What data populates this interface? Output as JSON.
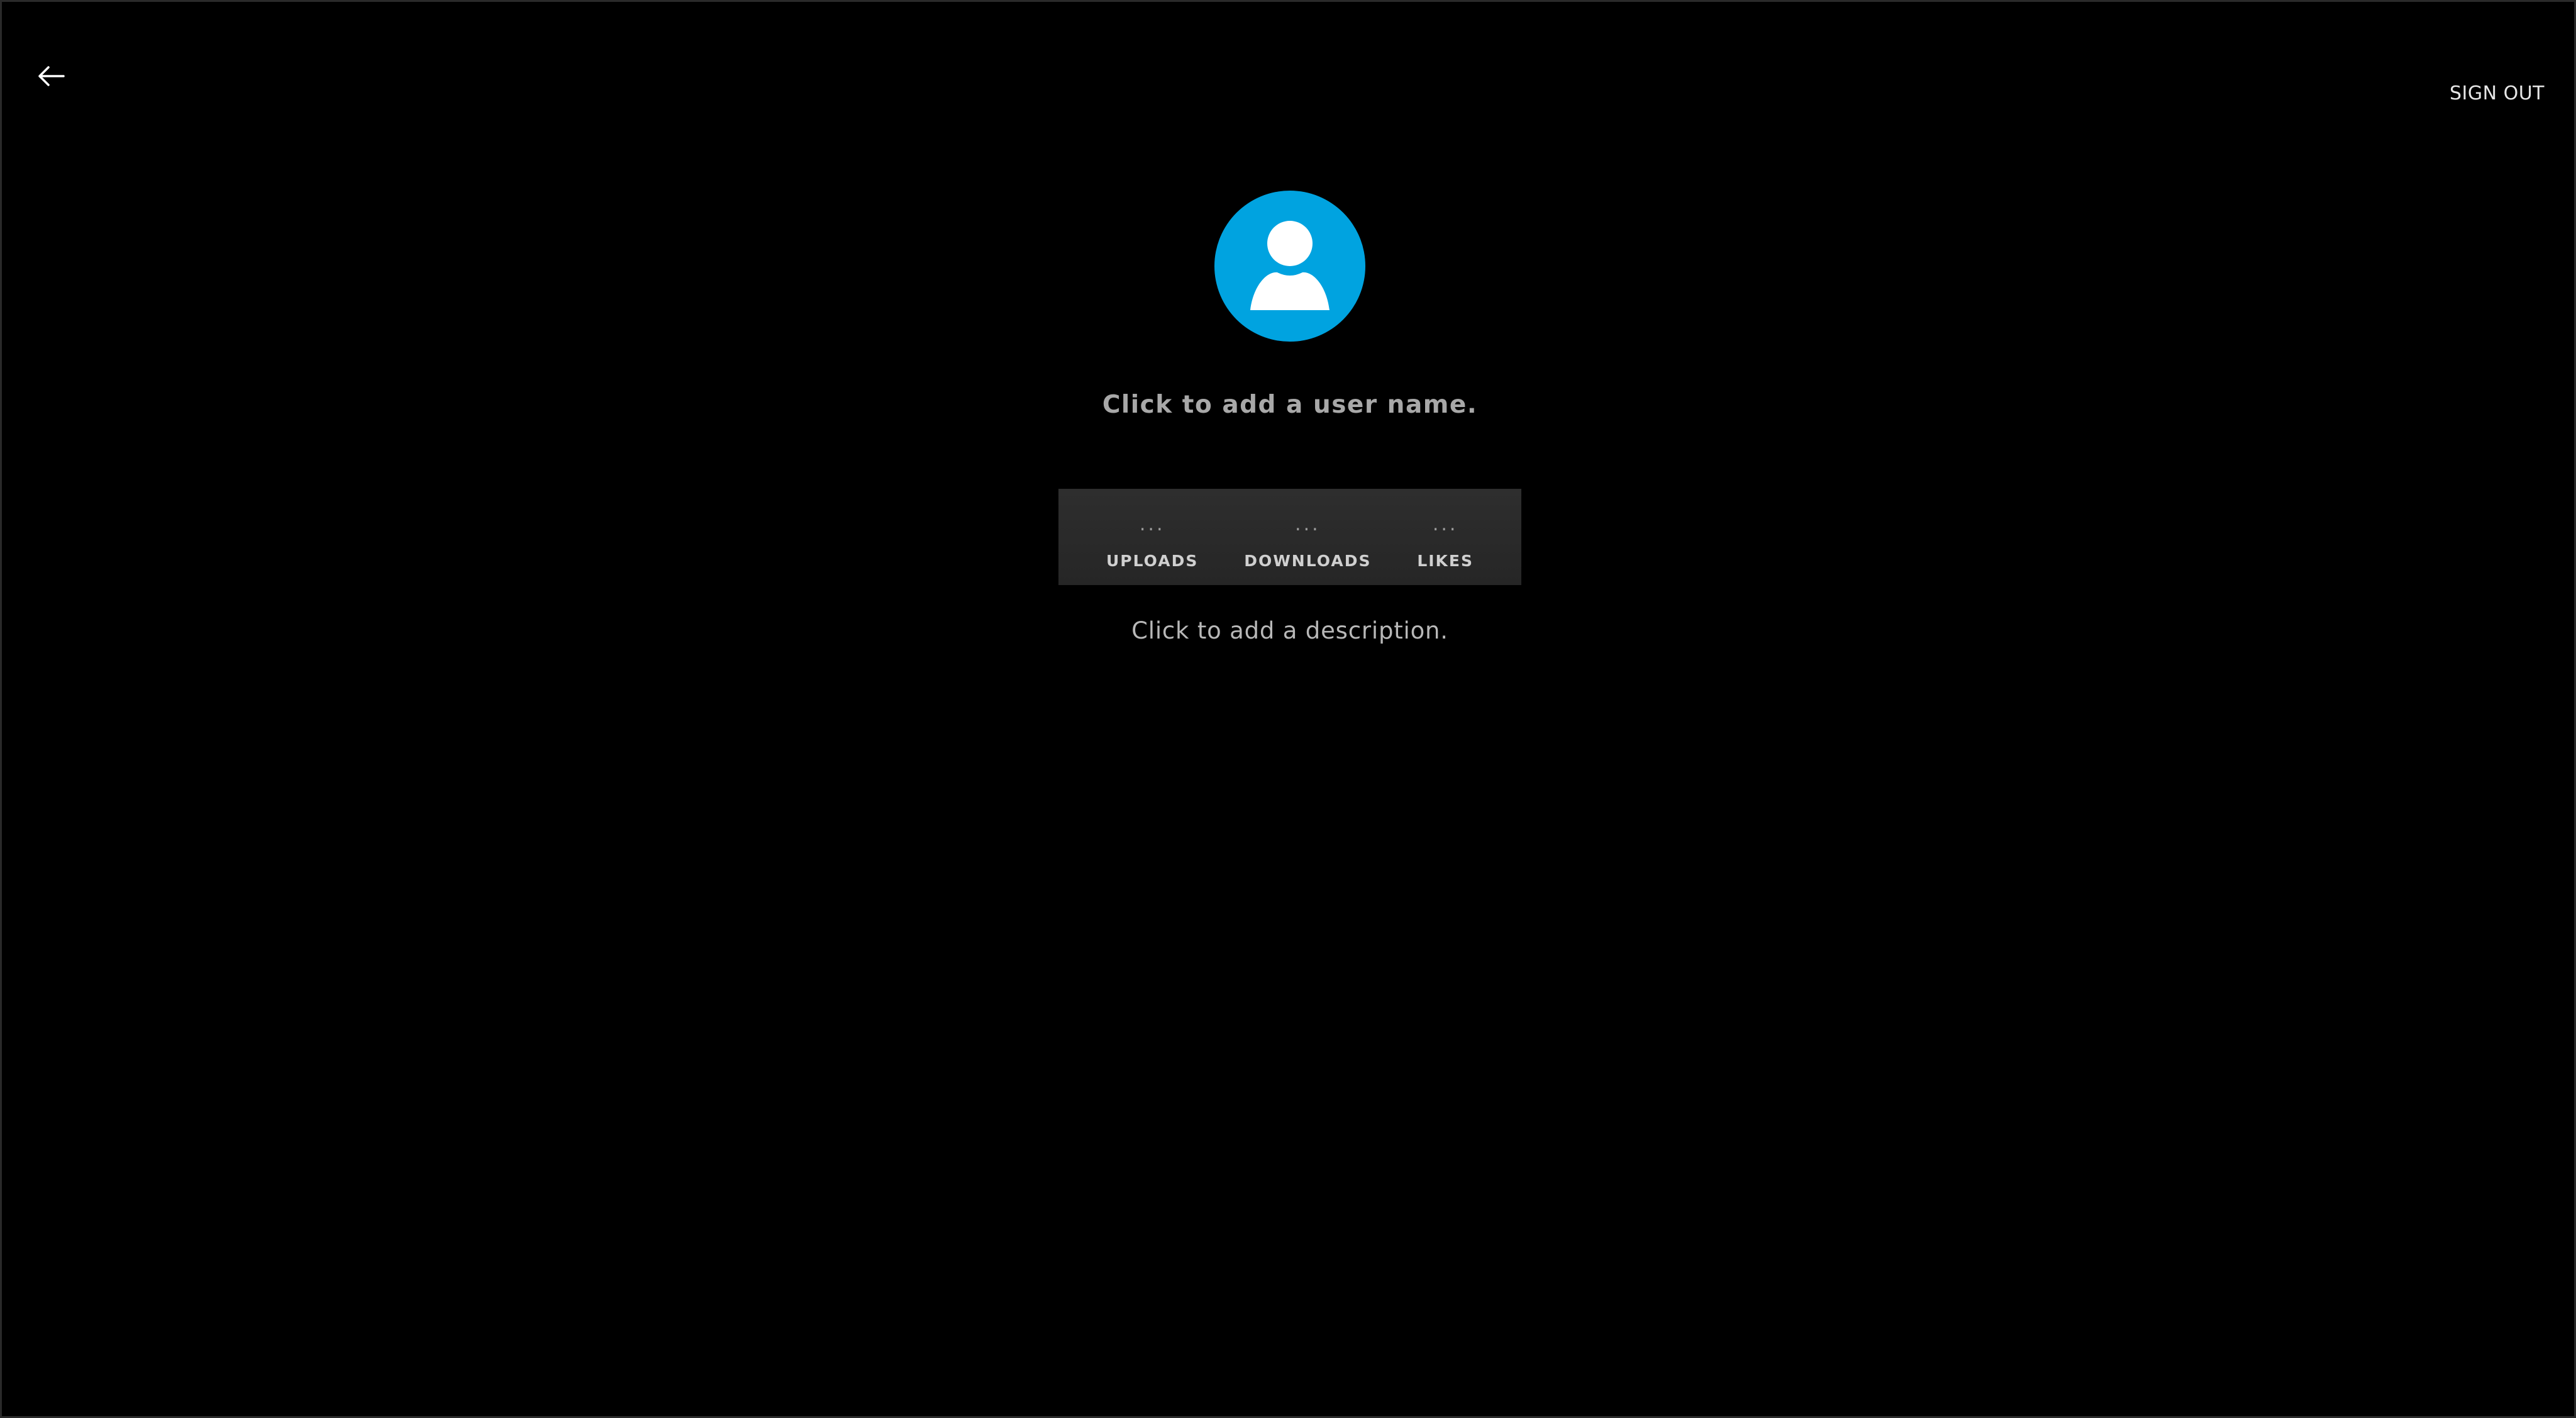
{
  "header": {
    "back_icon": "arrow-left-icon",
    "sign_out_label": "SIGN OUT"
  },
  "profile": {
    "avatar_icon": "user-silhouette-icon",
    "avatar_color": "#00a3e0",
    "user_name_placeholder": "Click to add a user name.",
    "description_placeholder": "Click to add a description."
  },
  "stats": [
    {
      "value": "...",
      "label": "UPLOADS"
    },
    {
      "value": "...",
      "label": "DOWNLOADS"
    },
    {
      "value": "...",
      "label": "LIKES"
    }
  ]
}
